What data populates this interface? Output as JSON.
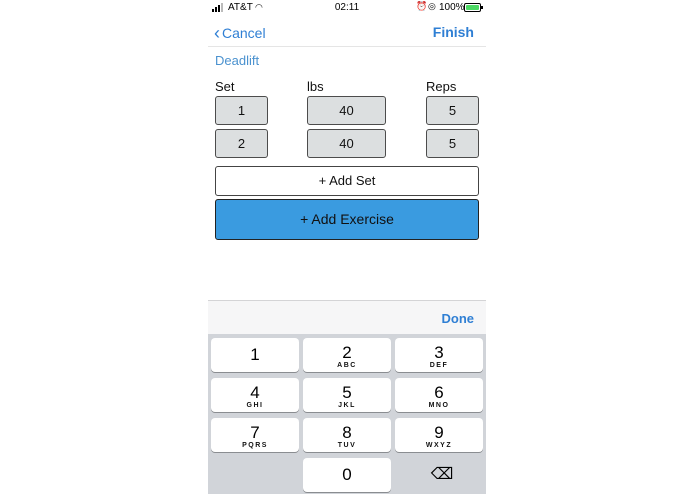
{
  "status_bar": {
    "carrier": "AT&T",
    "time": "02:11",
    "battery_percent": "100%"
  },
  "nav": {
    "cancel_label": "Cancel",
    "finish_label": "Finish"
  },
  "exercise": {
    "name": "Deadlift",
    "columns": {
      "set": "Set",
      "lbs": "lbs",
      "reps": "Reps"
    },
    "rows": [
      {
        "set": "1",
        "lbs": "40",
        "reps": "5"
      },
      {
        "set": "2",
        "lbs": "40",
        "reps": "5"
      }
    ]
  },
  "actions": {
    "add_set": "+ Add Set",
    "add_exercise": "+ Add Exercise"
  },
  "keyboard": {
    "done_label": "Done",
    "keys": [
      {
        "num": "1",
        "letters": ""
      },
      {
        "num": "2",
        "letters": "ABC"
      },
      {
        "num": "3",
        "letters": "DEF"
      },
      {
        "num": "4",
        "letters": "GHI"
      },
      {
        "num": "5",
        "letters": "JKL"
      },
      {
        "num": "6",
        "letters": "MNO"
      },
      {
        "num": "7",
        "letters": "PQRS"
      },
      {
        "num": "8",
        "letters": "TUV"
      },
      {
        "num": "9",
        "letters": "WXYZ"
      },
      {
        "num": "0",
        "letters": ""
      }
    ],
    "backspace_icon": "backspace-icon"
  },
  "colors": {
    "accent": "#2f7fd4",
    "primary_button": "#3a9be0",
    "input_cell": "#dcdfe0"
  }
}
